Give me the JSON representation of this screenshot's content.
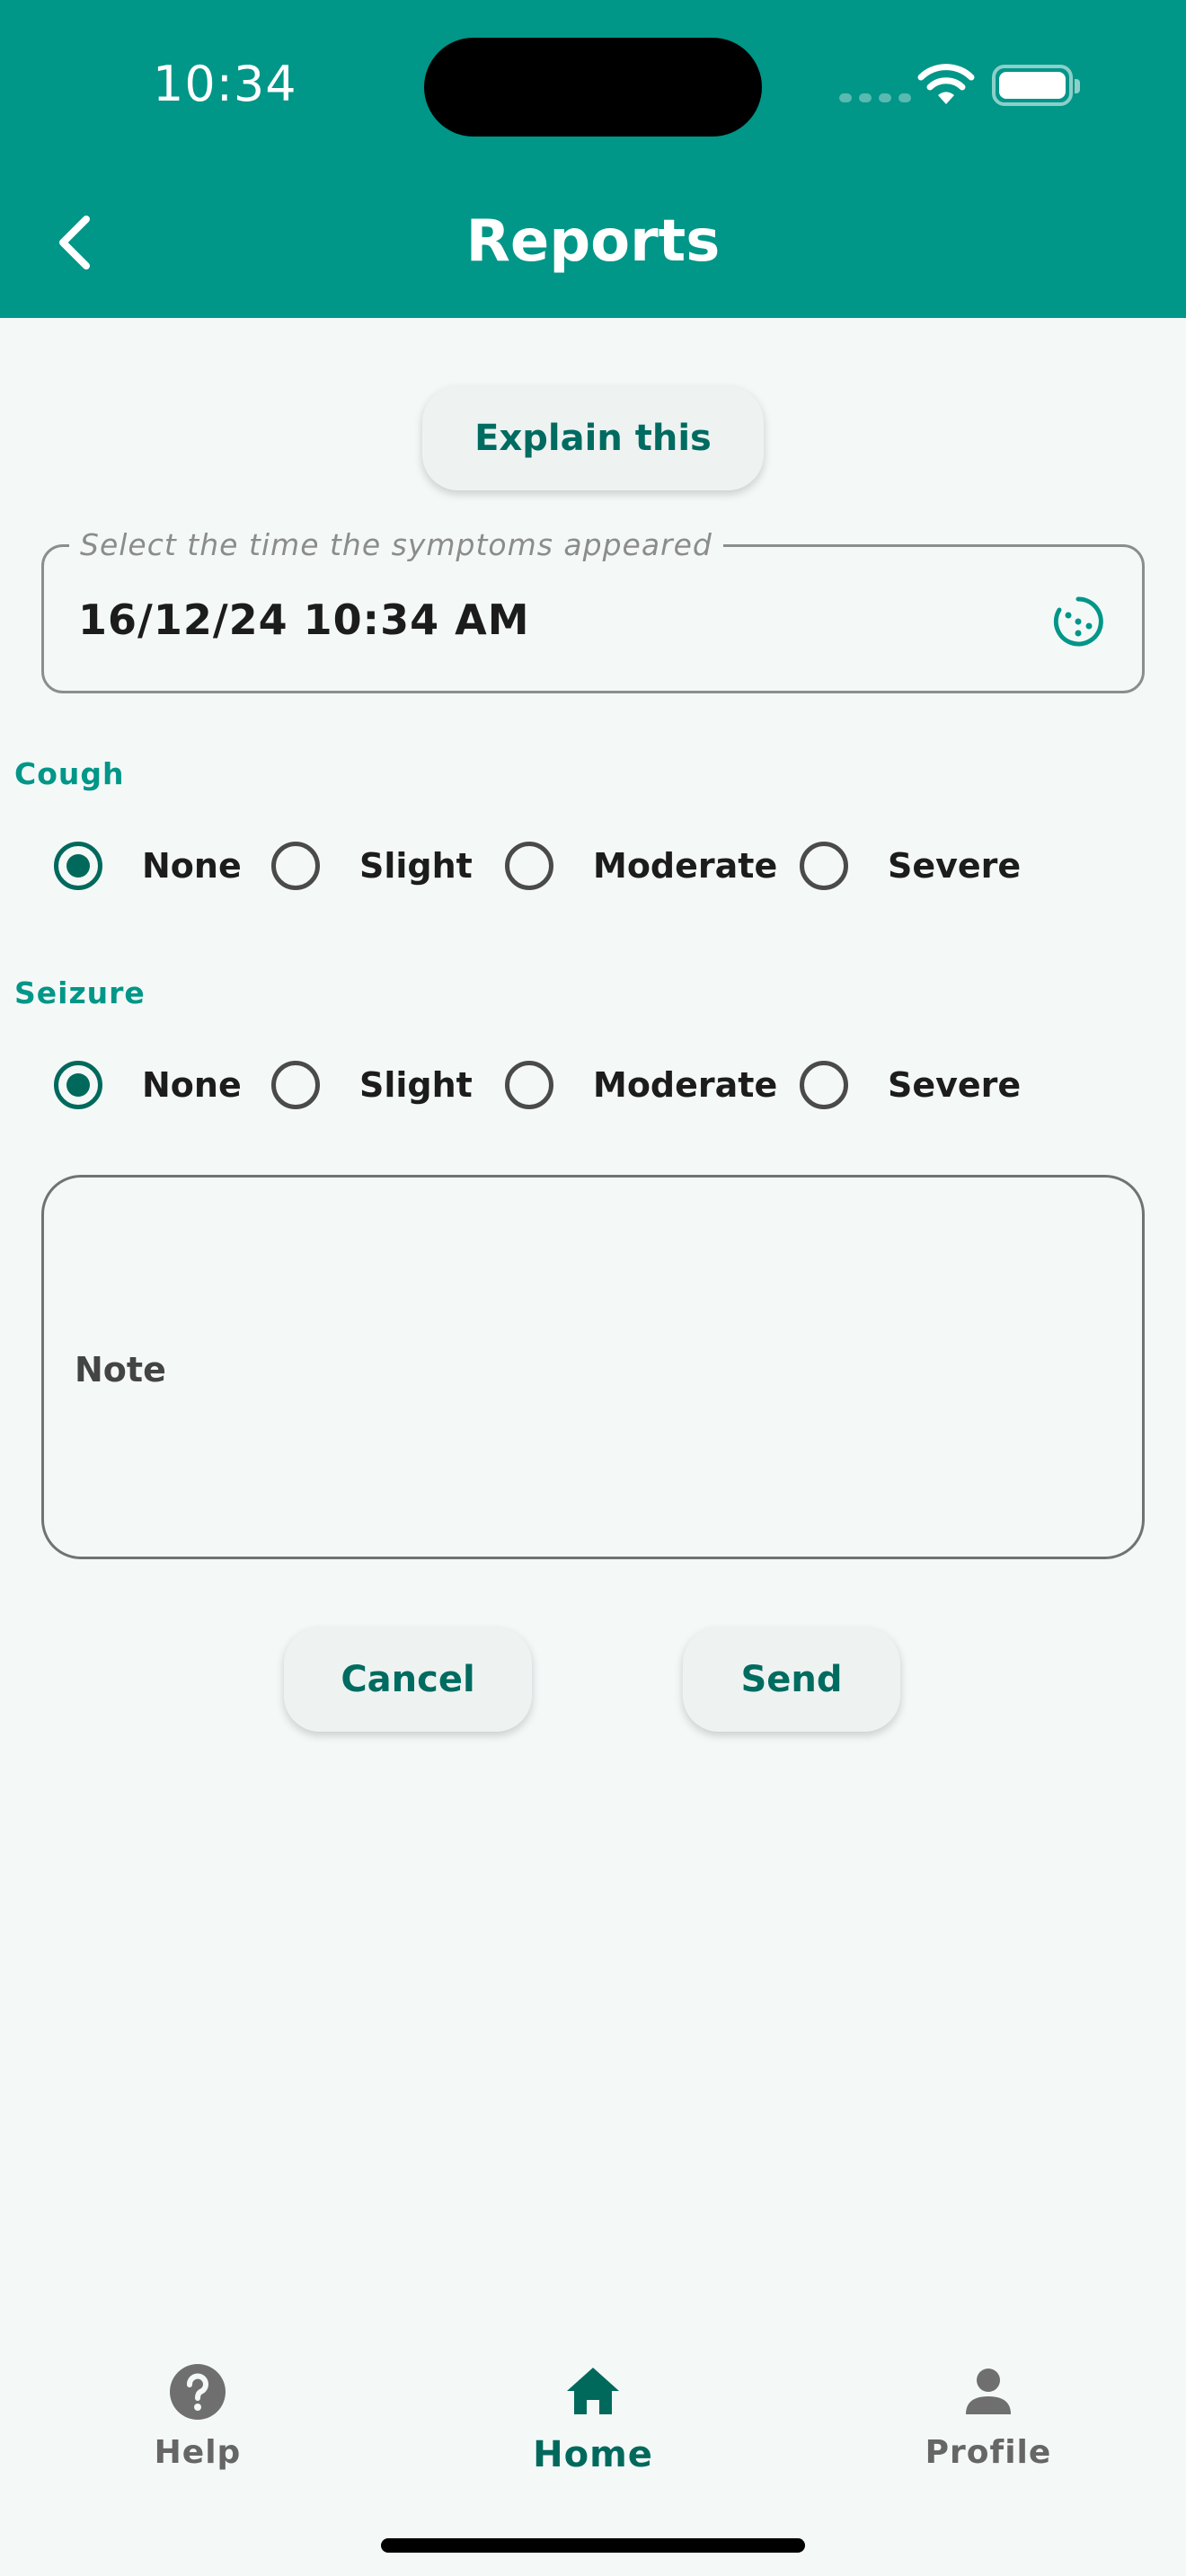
{
  "status_bar": {
    "time": "10:34"
  },
  "header": {
    "title": "Reports"
  },
  "explain_button": {
    "label": "Explain this"
  },
  "time_field": {
    "legend": "Select the time the symptoms appeared",
    "value": "16/12/24 10:34 AM"
  },
  "cough": {
    "label": "Cough",
    "options": [
      "None",
      "Slight",
      "Moderate",
      "Severe"
    ],
    "selected": "None"
  },
  "seizure": {
    "label": "Seizure",
    "options": [
      "None",
      "Slight",
      "Moderate",
      "Severe"
    ],
    "selected": "None"
  },
  "note": {
    "label": "Note"
  },
  "actions": {
    "cancel_label": "Cancel",
    "send_label": "Send"
  },
  "bottom_nav": {
    "items": [
      {
        "label": "Help",
        "icon": "help-icon"
      },
      {
        "label": "Home",
        "icon": "home-icon",
        "active": true
      },
      {
        "label": "Profile",
        "icon": "profile-icon"
      }
    ]
  },
  "colors": {
    "header": "#009688",
    "accent": "#00695c",
    "background": "#f4f9f8"
  }
}
